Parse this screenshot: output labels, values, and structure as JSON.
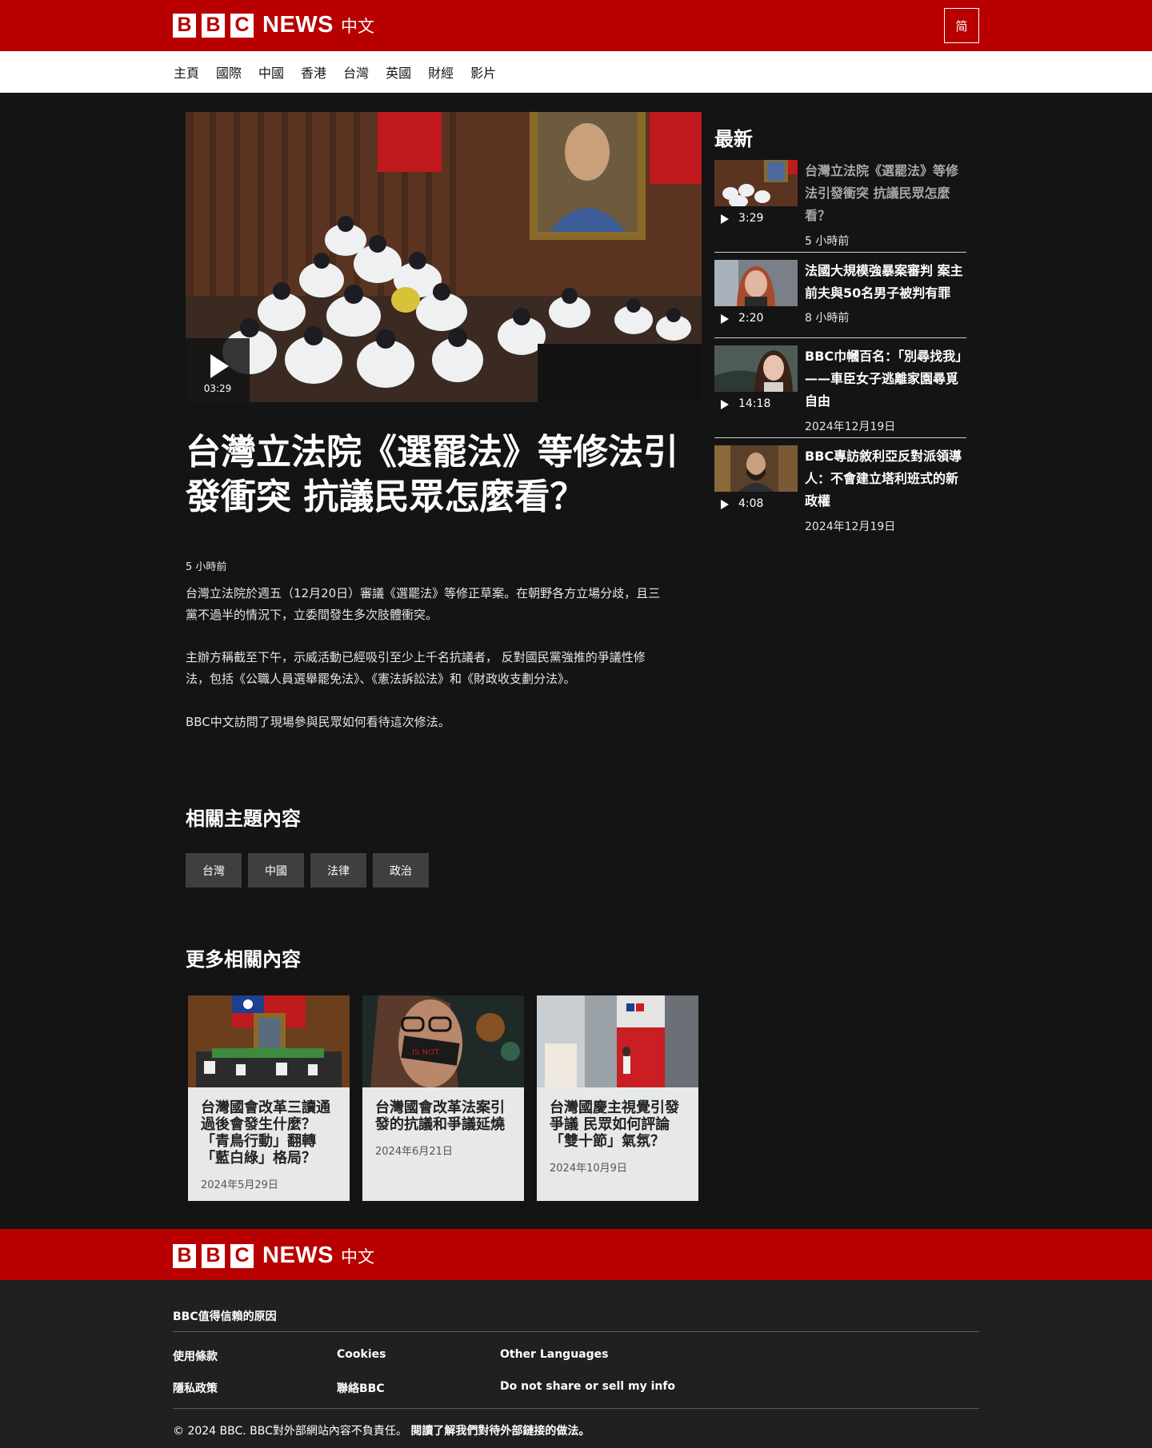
{
  "header": {
    "bbc_letters": [
      "B",
      "B",
      "C"
    ],
    "news_label": "NEWS",
    "language_label": "中文",
    "script_toggle": "简"
  },
  "nav": {
    "items": [
      "主頁",
      "國際",
      "中國",
      "香港",
      "台灣",
      "英國",
      "財經",
      "影片"
    ]
  },
  "article": {
    "video_duration": "03:29",
    "headline": "台灣立法院《選罷法》等修法引發衝突 抗議民眾怎麼看？",
    "published": "5 小時前",
    "paragraphs": [
      "台灣立法院於週五（12月20日）審議《選罷法》等修正草案。在朝野各方立場分歧，且三黨不過半的情況下，立委間發生多次肢體衝突。",
      "主辦方稱截至下午，示威活動已經吸引至少上千名抗議者， 反對國民黨強推的爭議性修法，包括《公職人員選舉罷免法》、《憲法訴訟法》和《財政收支劃分法》。",
      "BBC中文訪問了現場參與民眾如何看待這次修法。"
    ]
  },
  "topics": {
    "title": "相關主題內容",
    "items": [
      "台灣",
      "中國",
      "法律",
      "政治"
    ]
  },
  "related": {
    "title": "更多相關內容",
    "cards": [
      {
        "title": "台灣國會改革三讀通過後會發生什麼？「青鳥行動」翻轉「藍白綠」格局？",
        "date": "2024年5月29日"
      },
      {
        "title": "台灣國會改革法案引發的抗議和爭議延燒",
        "date": "2024年6月21日"
      },
      {
        "title": "台灣國慶主視覺引發爭議 民眾如何評論「雙十節」氣氛？",
        "date": "2024年10月9日"
      }
    ]
  },
  "sidebar": {
    "title": "最新",
    "items": [
      {
        "duration": "3:29",
        "title": "台灣立法院《選罷法》等修法引發衝突 抗議民眾怎麼看？",
        "date": "5 小時前"
      },
      {
        "duration": "2:20",
        "title": "法國大規模強暴案審判 案主前夫與50名男子被判有罪",
        "date": "8 小時前"
      },
      {
        "duration": "14:18",
        "title": "BBC巾幗百名：「別尋找我」——車臣女子逃離家園尋覓自由",
        "date": "2024年12月19日"
      },
      {
        "duration": "4:08",
        "title": "BBC專訪敘利亞反對派領導人：不會建立塔利班式的新政權",
        "date": "2024年12月19日"
      }
    ]
  },
  "footer": {
    "trust_heading": "BBC值得信賴的原因",
    "links": [
      "使用條款",
      "Cookies",
      "Other Languages",
      "隱私政策",
      "聯絡BBC",
      "Do not share or sell my info"
    ],
    "copyright": "© 2024 BBC. BBC對外部網站內容不負責任。",
    "external_policy": "閱讀了解我們對待外部鏈接的做法。"
  },
  "colors": {
    "brand_red": "#b80000",
    "page_bg": "#141414",
    "footer_bg": "#202020",
    "card_bg": "#e6e8ea"
  }
}
